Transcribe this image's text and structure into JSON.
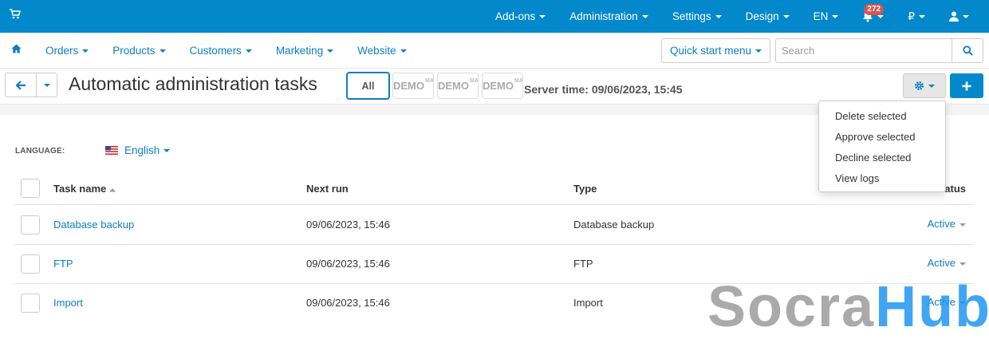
{
  "topbar": {
    "items": [
      "Add-ons",
      "Administration",
      "Settings",
      "Design",
      "EN"
    ],
    "notifications_count": "272",
    "currency": "₽"
  },
  "subnav": {
    "items": [
      "Orders",
      "Products",
      "Customers",
      "Marketing",
      "Website"
    ],
    "quick_start": "Quick start menu",
    "search_placeholder": "Search"
  },
  "page": {
    "title": "Automatic administration tasks",
    "filter_all": "All",
    "filter_demo": "DEMO",
    "filter_demo_small": "MA",
    "server_time": "Server time: 09/06/2023, 15:45"
  },
  "dropdown": {
    "items": [
      "Delete selected",
      "Approve selected",
      "Decline selected",
      "View logs"
    ]
  },
  "language": {
    "label": "LANGUAGE:",
    "value": "English"
  },
  "table": {
    "headers": {
      "name": "Task name",
      "next_run": "Next run",
      "type": "Type",
      "status": "Status"
    },
    "rows": [
      {
        "name": "Database backup",
        "next_run": "09/06/2023, 15:46",
        "type": "Database backup",
        "status": "Active"
      },
      {
        "name": "FTP",
        "next_run": "09/06/2023, 15:46",
        "type": "FTP",
        "status": "Active"
      },
      {
        "name": "Import",
        "next_run": "09/06/2023, 15:46",
        "type": "Import",
        "status": "Active"
      }
    ]
  },
  "watermark": {
    "part1": "Socra",
    "part2": "Hub"
  },
  "colors": {
    "primary": "#0388cc",
    "link": "#0d7ec1",
    "badge": "#d9534f"
  }
}
